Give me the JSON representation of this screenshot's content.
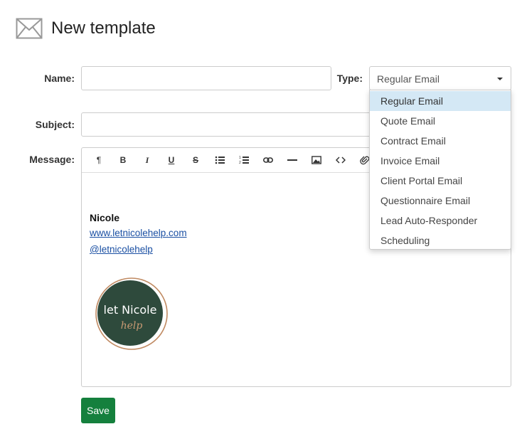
{
  "header": {
    "title": "New template",
    "icon": "envelope-icon"
  },
  "form": {
    "name_label": "Name:",
    "name_value": "",
    "type_label": "Type:",
    "type_selected": "Regular Email",
    "subject_label": "Subject:",
    "subject_value": "",
    "message_label": "Message:"
  },
  "toolbar": {
    "buttons": [
      "paragraph",
      "bold",
      "italic",
      "underline",
      "strikethrough",
      "bullet-list",
      "numbered-list",
      "link",
      "horizontal-rule",
      "image",
      "code",
      "attachment"
    ]
  },
  "message": {
    "signature_name": "Nicole",
    "website": "www.letnicolehelp.com",
    "handle": "@letnicolehelp",
    "logo_text_1": "let Nicole",
    "logo_text_2": "help"
  },
  "dropdown": {
    "options": [
      "Regular Email",
      "Quote Email",
      "Contract Email",
      "Invoice Email",
      "Client Portal Email",
      "Questionnaire Email",
      "Lead Auto-Responder",
      "Scheduling"
    ],
    "highlighted": "Regular Email"
  },
  "save_label": "Save",
  "colors": {
    "save": "#15803d",
    "highlight": "#d4e8f5",
    "link": "#1a4fa3",
    "logo_bg": "#2e4a3c",
    "logo_ring": "#c08a62"
  }
}
